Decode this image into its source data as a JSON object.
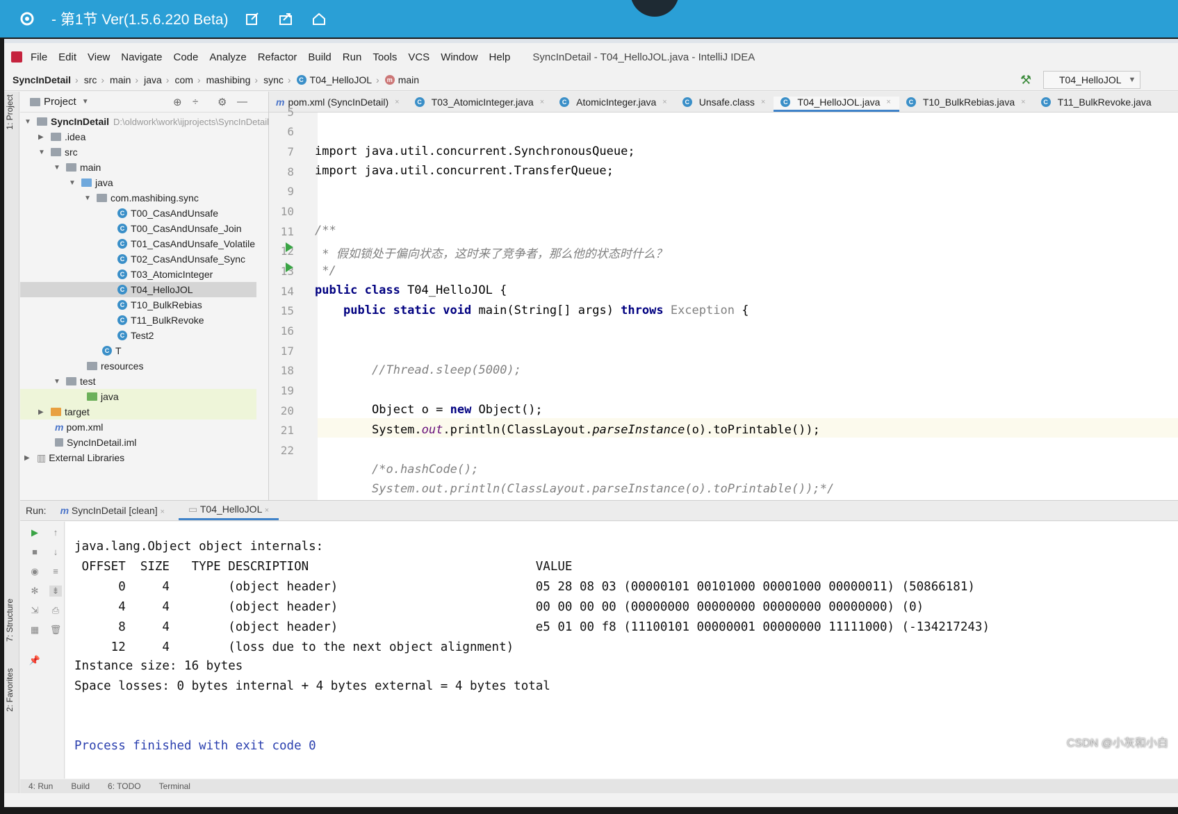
{
  "player": {
    "title": "- 第1节 Ver(1.5.6.220 Beta)",
    "icons": [
      "settings-icon",
      "edit-icon",
      "share-icon",
      "home-icon"
    ]
  },
  "menu": {
    "items": [
      "File",
      "Edit",
      "View",
      "Navigate",
      "Code",
      "Analyze",
      "Refactor",
      "Build",
      "Run",
      "Tools",
      "VCS",
      "Window",
      "Help"
    ],
    "window_title": "SyncInDetail - T04_HelloJOL.java - IntelliJ IDEA"
  },
  "breadcrumb": {
    "items": [
      "SyncInDetail",
      "src",
      "main",
      "java",
      "com",
      "mashibing",
      "sync",
      "T04_HelloJOL",
      "main"
    ],
    "run_config": "T04_HelloJOL"
  },
  "sidebar": {
    "vertical_tabs": [
      "1: Project",
      "7: Structure",
      "2: Favorites"
    ]
  },
  "project": {
    "header": "Project",
    "tree": [
      {
        "label": "SyncInDetail",
        "path": "D:\\oldwork\\work\\ijprojects\\SyncInDetail",
        "bold": true
      },
      {
        "label": ".idea"
      },
      {
        "label": "src"
      },
      {
        "label": "main"
      },
      {
        "label": "java"
      },
      {
        "label": "com.mashibing.sync"
      },
      {
        "label": "T00_CasAndUnsafe"
      },
      {
        "label": "T00_CasAndUnsafe_Join"
      },
      {
        "label": "T01_CasAndUnsafe_Volatile"
      },
      {
        "label": "T02_CasAndUnsafe_Sync"
      },
      {
        "label": "T03_AtomicInteger"
      },
      {
        "label": "T04_HelloJOL"
      },
      {
        "label": "T10_BulkRebias"
      },
      {
        "label": "T11_BulkRevoke"
      },
      {
        "label": "Test2"
      },
      {
        "label": "T"
      },
      {
        "label": "resources"
      },
      {
        "label": "test"
      },
      {
        "label": "java"
      },
      {
        "label": "target"
      },
      {
        "label": "pom.xml"
      },
      {
        "label": "SyncInDetail.iml"
      },
      {
        "label": "External Libraries"
      }
    ]
  },
  "editor": {
    "tabs": [
      {
        "label": "pom.xml (SyncInDetail)"
      },
      {
        "label": "T03_AtomicInteger.java"
      },
      {
        "label": "AtomicInteger.java"
      },
      {
        "label": "Unsafe.class"
      },
      {
        "label": "T04_HelloJOL.java",
        "active": true
      },
      {
        "label": "T10_BulkRebias.java"
      },
      {
        "label": "T11_BulkRevoke.java"
      }
    ],
    "line_numbers": [
      "5",
      "6",
      "7",
      "8",
      "9",
      "10",
      "11",
      "12",
      "13",
      "14",
      "15",
      "16",
      "17",
      "18",
      "19",
      "20",
      "21",
      "22"
    ],
    "lines": {
      "l5": "import java.util.concurrent.SynchronousQueue;",
      "l6": "import java.util.concurrent.TransferQueue;",
      "l9": "/**",
      "l10": " * 假如锁处于偏向状态，这时来了竞争者，那么他的状态时什么？",
      "l11": " */",
      "l12_kw": "public class",
      "l12_rest": " T04_HelloJOL {",
      "l13_kw1": "public static void",
      "l13_mid": " main(String[] args) ",
      "l13_kw2": "throws",
      "l13_ex": " Exception",
      "l13_end": " {",
      "l16": "//Thread.sleep(5000);",
      "l18_a": "Object o = ",
      "l18_kw": "new",
      "l18_b": " Object();",
      "l19_a": "System.",
      "l19_fld": "out",
      "l19_b": ".println(ClassLayout.",
      "l19_m": "parseInstance",
      "l19_c": "(o).toPrintable());",
      "l21": "/*o.hashCode();",
      "l22": "System.out.println(ClassLayout.parseInstance(o).toPrintable());*/"
    }
  },
  "run": {
    "label": "Run:",
    "tabs": [
      "SyncInDetail [clean]",
      "T04_HelloJOL"
    ],
    "console": [
      "java.lang.Object object internals:",
      " OFFSET  SIZE   TYPE DESCRIPTION                               VALUE",
      "      0     4        (object header)                           05 28 08 03 (00000101 00101000 00001000 00000011) (50866181)",
      "      4     4        (object header)                           00 00 00 00 (00000000 00000000 00000000 00000000) (0)",
      "      8     4        (object header)                           e5 01 00 f8 (11100101 00000001 00000000 11111000) (-134217243)",
      "     12     4        (loss due to the next object alignment)",
      "Instance size: 16 bytes",
      "Space losses: 0 bytes internal + 4 bytes external = 4 bytes total",
      "Process finished with exit code 0"
    ]
  },
  "bottom_bar": [
    "4: Run",
    "Build",
    "6: TODO",
    "Terminal"
  ],
  "watermark": "CSDN @小灰和小白",
  "colors": {
    "player_bar": "#2a9fd6",
    "keyword": "#000080",
    "comment": "#808080",
    "exit_text": "#2a3fae",
    "run_green": "#3aa445"
  }
}
